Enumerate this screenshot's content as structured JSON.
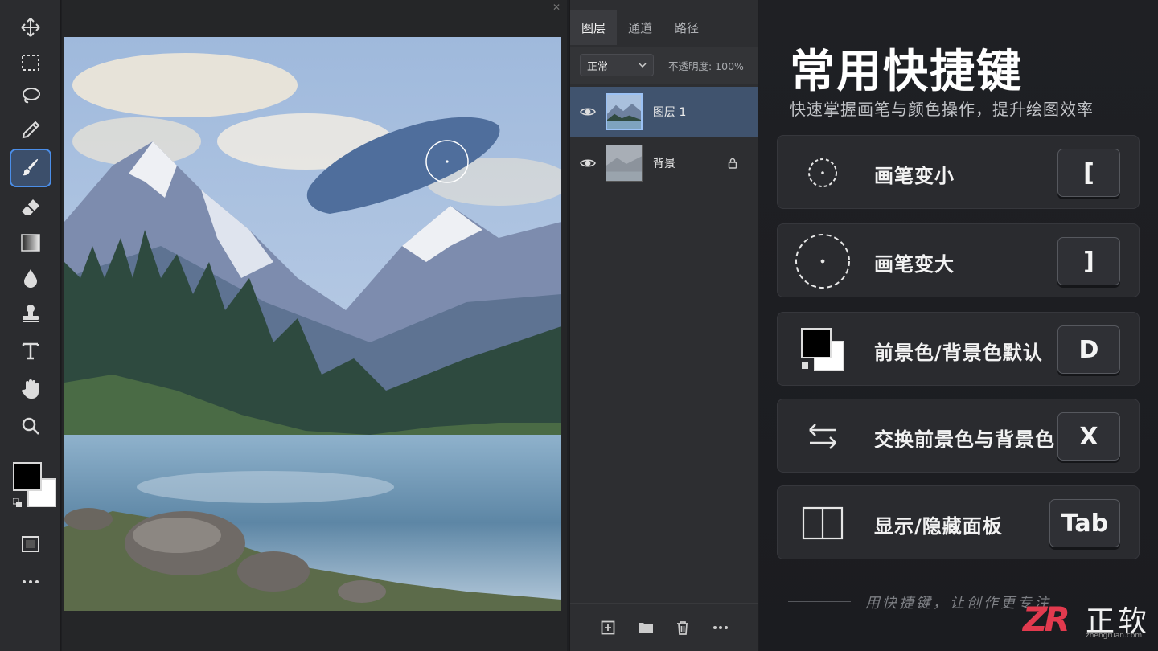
{
  "toolbar": {
    "tools": [
      {
        "icon": "move-icon"
      },
      {
        "icon": "marquee-icon"
      },
      {
        "icon": "lasso-icon"
      },
      {
        "icon": "eyedropper-icon"
      },
      {
        "icon": "brush-icon",
        "active": true
      },
      {
        "icon": "eraser-icon"
      },
      {
        "icon": "gradient-icon"
      },
      {
        "icon": "blur-drop-icon"
      },
      {
        "icon": "stamp-icon"
      },
      {
        "icon": "text-icon"
      },
      {
        "icon": "hand-icon"
      },
      {
        "icon": "zoom-icon"
      }
    ],
    "foreground_color": "#000000",
    "background_color": "#ffffff",
    "screen_mode_icon": "screen-mode-icon",
    "more_icon": "more-icon"
  },
  "layers_panel": {
    "tabs": [
      "图层",
      "通道",
      "路径"
    ],
    "active_tab": "图层",
    "blend_mode": "正常",
    "opacity_label": "不透明度: 100%",
    "layers": [
      {
        "name": "图层 1",
        "selected": true,
        "visible": true,
        "locked": false
      },
      {
        "name": "背景",
        "selected": false,
        "visible": true,
        "locked": true
      }
    ]
  },
  "shortcuts": {
    "title": "常用快捷键",
    "subtitle": "快速掌握画笔与颜色操作，提升绘图效率",
    "items": [
      {
        "icon": "brush-smaller-icon",
        "label": "画笔变小",
        "key": "["
      },
      {
        "icon": "brush-larger-icon",
        "label": "画笔变大",
        "key": "]"
      },
      {
        "icon": "default-colors-icon",
        "label": "前景色/背景色默认",
        "key": "D"
      },
      {
        "icon": "swap-colors-icon",
        "label": "交换前景色与背景色",
        "key": "X"
      },
      {
        "icon": "panels-icon",
        "label": "显示/隐藏面板",
        "key": "Tab"
      }
    ],
    "footer": "用快捷键，让创作更专注"
  },
  "brand": {
    "logo": "ZR",
    "name": "正软",
    "url": "zhengruan.com",
    "accent": "#e23a4e"
  }
}
